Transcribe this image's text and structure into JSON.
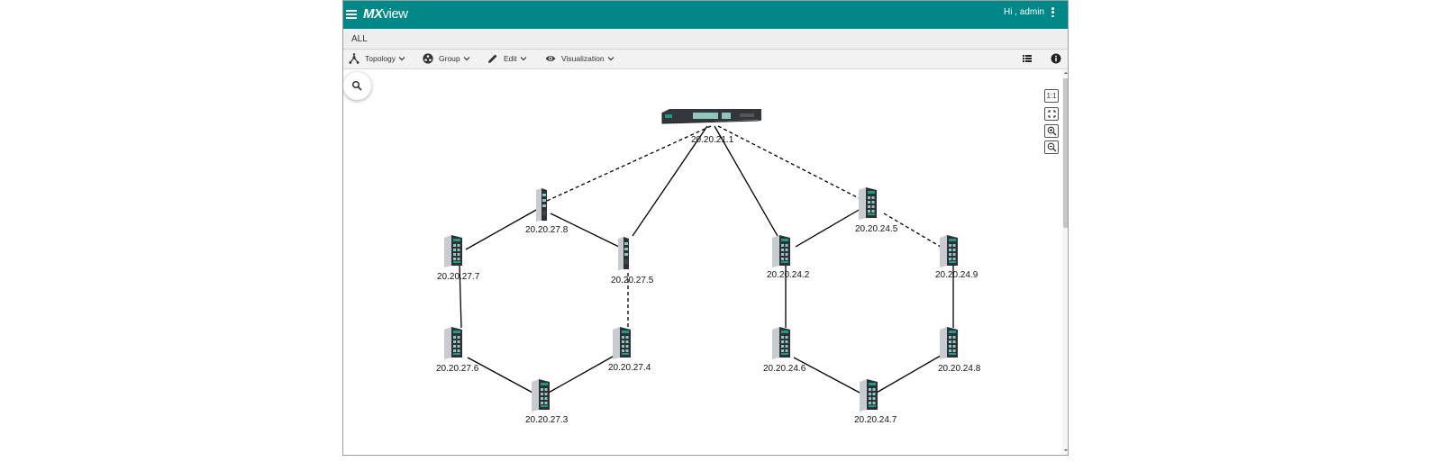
{
  "app": {
    "logo_mx": "MX",
    "logo_view": "view",
    "greeting": "Hi , admin"
  },
  "breadcrumb": {
    "label": "ALL"
  },
  "toolbar": {
    "topology": "Topology",
    "group": "Group",
    "edit": "Edit",
    "visualization": "Visualization"
  },
  "zoom": {
    "reset_label": "1:1"
  },
  "devices": {
    "core": "20.20.21.1",
    "d2778": "20.20.27.8",
    "d2777": "20.20.27.7",
    "d2775": "20.20.27.5",
    "d2776": "20.20.27.6",
    "d2774": "20.20.27.4",
    "d2773": "20.20.27.3",
    "d2442": "20.20.24.2",
    "d2445": "20.20.24.5",
    "d2449": "20.20.24.9",
    "d2446": "20.20.24.6",
    "d2448": "20.20.24.8",
    "d2447": "20.20.24.7"
  },
  "colors": {
    "header": "#008787",
    "link": "#000000"
  }
}
